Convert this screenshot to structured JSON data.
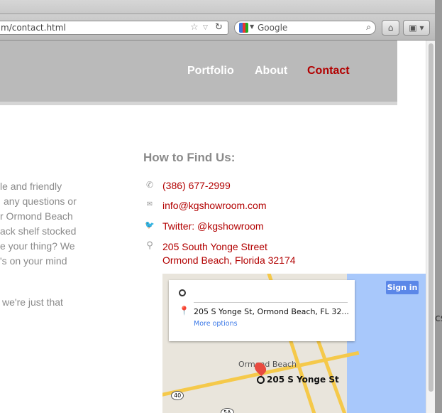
{
  "browser": {
    "url": "m/contact.html",
    "search_placeholder": "Google"
  },
  "nav": {
    "items": [
      {
        "label": "Portfolio"
      },
      {
        "label": "About"
      },
      {
        "label": "Contact",
        "active": true
      }
    ]
  },
  "intro_lines": [
    "le and friendly",
    "any questions or",
    "r Ormond Beach",
    "ack shelf stocked",
    "e your thing? We",
    "'s on your mind",
    "we're just that"
  ],
  "find_us": {
    "heading": "How to Find Us:",
    "phone": "(386) 677-2999",
    "email": "info@kgshowroom.com",
    "twitter": "Twitter: @kgshowroom",
    "address_line1": "205 South Yonge Street",
    "address_line2": "Ormond Beach, Florida 32174"
  },
  "map": {
    "destination": "205 S Yonge St, Ormond Beach, FL 32...",
    "more_options": "More options",
    "sign_in": "Sign in",
    "city_label": "Ormond Beach",
    "pin_label": "205 S Yonge St",
    "road_40": "40",
    "road_5a": "5A"
  },
  "background_window": {
    "text": "cs"
  },
  "colors": {
    "accent": "#b20000",
    "header_bg": "#bababa",
    "muted_text": "#8a8a8a",
    "map_water": "#a8c8fb"
  }
}
